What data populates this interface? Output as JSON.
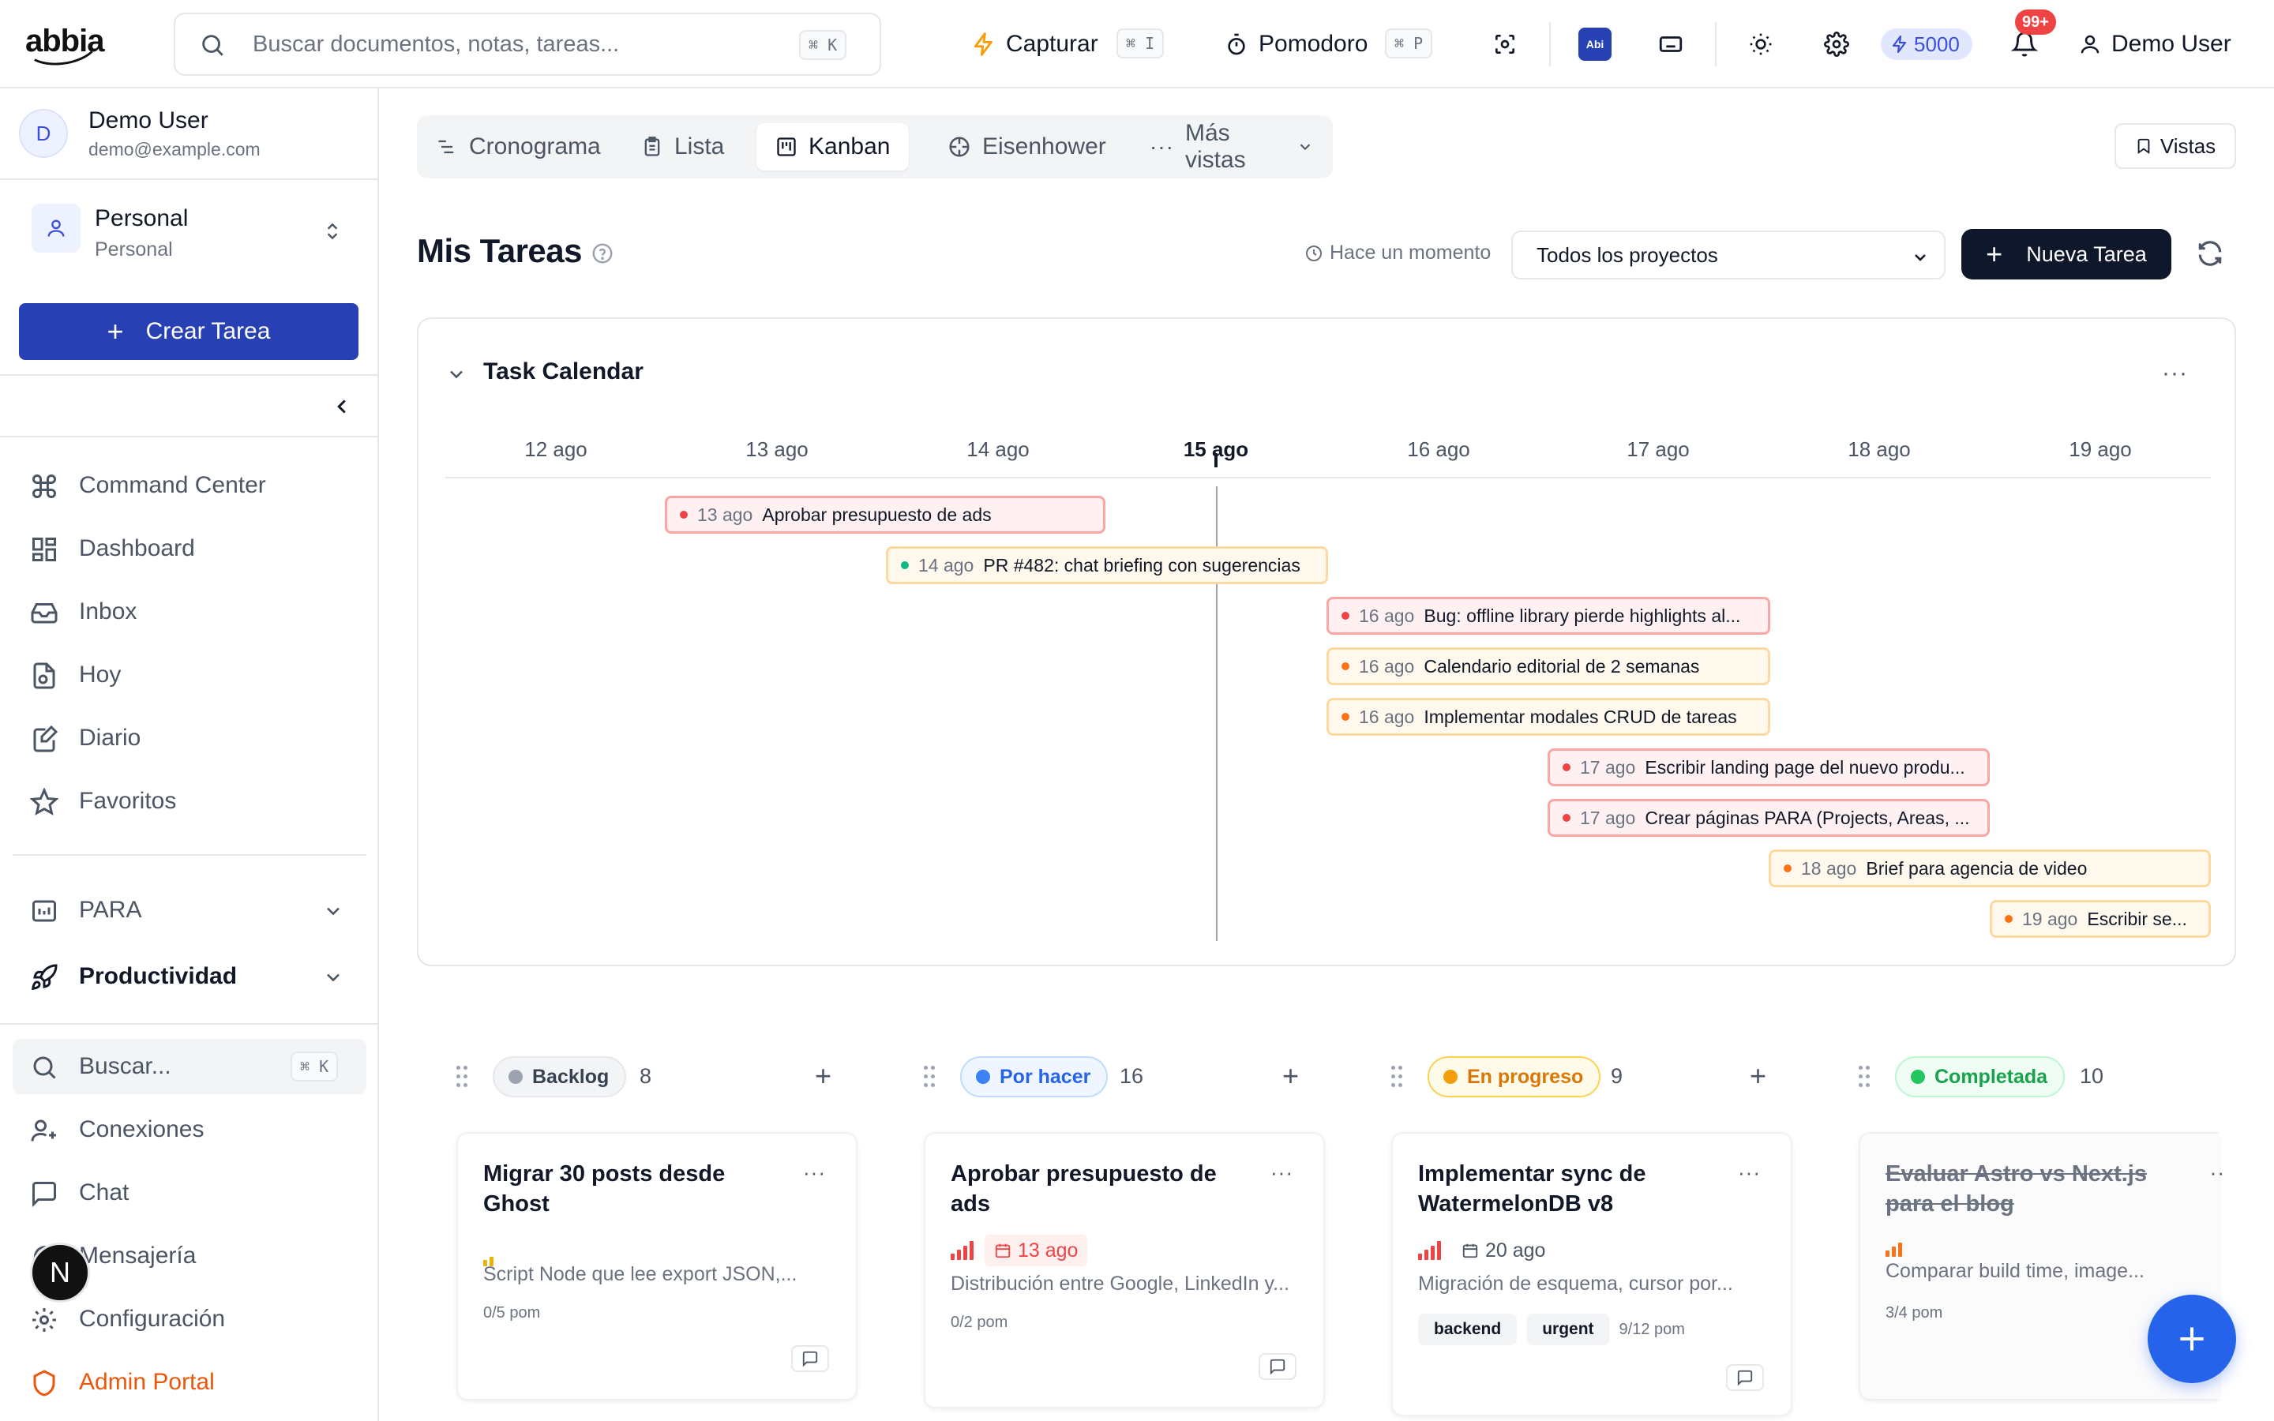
{
  "header": {
    "logo_text": "abbia",
    "search": {
      "placeholder": "Buscar documentos, notas, tareas...",
      "shortcut": "⌘ K"
    },
    "capture": {
      "label": "Capturar",
      "shortcut": "⌘ I"
    },
    "pomodoro": {
      "label": "Pomodoro",
      "shortcut": "⌘ P"
    },
    "ai_badge": "Abi",
    "credits": "5000",
    "notifications_badge": "99+",
    "user_label": "Demo User"
  },
  "sidebar": {
    "user": {
      "initial": "D",
      "name": "Demo User",
      "email": "demo@example.com"
    },
    "workspace": {
      "title": "Personal",
      "subtitle": "Personal"
    },
    "create_button": "Crear Tarea",
    "nav": [
      {
        "label": "Command Center",
        "icon": "command-icon"
      },
      {
        "label": "Dashboard",
        "icon": "dashboard-icon"
      },
      {
        "label": "Inbox",
        "icon": "inbox-icon"
      },
      {
        "label": "Hoy",
        "icon": "today-icon"
      },
      {
        "label": "Diario",
        "icon": "journal-icon"
      },
      {
        "label": "Favoritos",
        "icon": "star-icon"
      }
    ],
    "groups": [
      {
        "label": "PARA",
        "icon": "folder-icon"
      },
      {
        "label": "Productividad",
        "icon": "rocket-icon"
      }
    ],
    "bottom": [
      {
        "label": "Buscar...",
        "icon": "search-icon",
        "shortcut": "⌘ K"
      },
      {
        "label": "Conexiones",
        "icon": "user-plus-icon"
      },
      {
        "label": "Chat",
        "icon": "chat-icon"
      },
      {
        "label": "Mensajería",
        "icon": "message-icon"
      },
      {
        "label": "Configuración",
        "icon": "gear-icon"
      },
      {
        "label": "Admin Portal",
        "icon": "admin-icon"
      }
    ],
    "admin_badge": "N"
  },
  "views": {
    "tabs": [
      {
        "label": "Cronograma",
        "icon": "timeline-icon"
      },
      {
        "label": "Lista",
        "icon": "list-icon"
      },
      {
        "label": "Kanban",
        "icon": "kanban-icon",
        "active": true
      },
      {
        "label": "Eisenhower",
        "icon": "eisenhower-icon"
      },
      {
        "label": "Más vistas",
        "icon": "more-icon"
      }
    ],
    "vistas_button": "Vistas"
  },
  "main": {
    "title": "Mis Tareas",
    "updated": "Hace un momento",
    "project_select": "Todos los proyectos",
    "new_task_button": "Nueva Tarea"
  },
  "calendar": {
    "title": "Task Calendar",
    "days": [
      "12 ago",
      "13 ago",
      "14 ago",
      "15 ago",
      "16 ago",
      "17 ago",
      "18 ago",
      "19 ago"
    ],
    "today": "15 ago",
    "events": [
      {
        "date": "13 ago",
        "title": "Aprobar presupuesto de ads",
        "priority": "red"
      },
      {
        "date": "14 ago",
        "title": "PR #482: chat briefing con sugerencias",
        "priority": "green"
      },
      {
        "date": "16 ago",
        "title": "Bug: offline library pierde highlights al...",
        "priority": "red"
      },
      {
        "date": "16 ago",
        "title": "Calendario editorial de 2 semanas",
        "priority": "orange"
      },
      {
        "date": "16 ago",
        "title": "Implementar modales CRUD de tareas",
        "priority": "orange"
      },
      {
        "date": "17 ago",
        "title": "Escribir landing page del nuevo produ...",
        "priority": "red"
      },
      {
        "date": "17 ago",
        "title": "Crear páginas PARA (Projects, Areas, ...",
        "priority": "red"
      },
      {
        "date": "18 ago",
        "title": "Brief para agencia de video",
        "priority": "orange"
      },
      {
        "date": "19 ago",
        "title": "Escribir se...",
        "priority": "orange"
      }
    ]
  },
  "kanban": {
    "columns": [
      {
        "name": "Backlog",
        "count": "8",
        "color": "#9ca3af",
        "card": {
          "title": "Migrar 30 posts desde Ghost",
          "desc": "Script Node que lee export JSON,...",
          "pomodoros": "0/5 pom",
          "priority": "low"
        }
      },
      {
        "name": "Por hacer",
        "count": "16",
        "color": "#3b82f6",
        "card": {
          "title": "Aprobar presupuesto de ads",
          "due": "13 ago",
          "desc": "Distribución entre Google, LinkedIn y...",
          "pomodoros": "0/2 pom",
          "priority": "urgent"
        }
      },
      {
        "name": "En progreso",
        "count": "9",
        "color": "#f59e0b",
        "card": {
          "title": "Implementar sync de WatermelonDB v8",
          "due": "20 ago",
          "desc": "Migración de esquema, cursor por...",
          "tags": [
            "backend",
            "urgent"
          ],
          "pomodoros": "9/12 pom",
          "priority": "urgent"
        }
      },
      {
        "name": "Completada",
        "count": "10",
        "color": "#22c55e",
        "card": {
          "title": "Evaluar Astro vs Next.js para el blog",
          "desc": "Comparar build time, image...",
          "pomodoros": "3/4 pom",
          "priority": "high"
        }
      }
    ]
  },
  "colors": {
    "primary": "#2740b3",
    "dark_button": "#0f172a",
    "fab": "#2563eb",
    "danger": "#ef4444"
  }
}
